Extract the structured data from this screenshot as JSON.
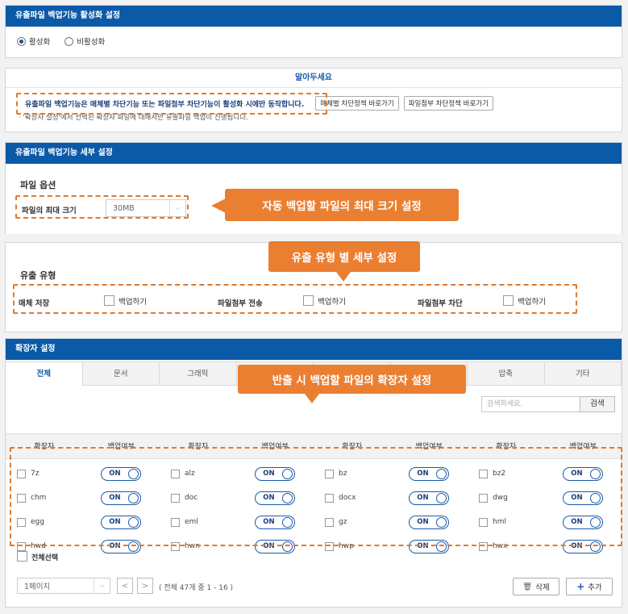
{
  "panel1": {
    "title": "유출파일 백업기능 활성화 설정",
    "radio_on": "활성화",
    "radio_off": "비활성화"
  },
  "notice": {
    "title": "알아두세요",
    "line1": "유출파일 백업기능은 매체별 차단기능 또는 파일첨부 차단기능이 활성화 시에만 동작합니다.",
    "btn_media": "매체별 차단정책 바로가기",
    "btn_attach": "파일첨부 차단정책 바로가기",
    "footnote": "· '확장자 설정'에서 선택된 확장자 파일에 대해서만 유출파일 백업이 진행됩니다."
  },
  "detail": {
    "title": "유출파일 백업기능 세부 설정",
    "file_option": "파일 옵션",
    "max_size_label": "파일의 최대 크기",
    "max_size_value": "30MB",
    "leak_type": "유출 유형",
    "types": [
      {
        "label": "매체 저장",
        "check": "백업하기"
      },
      {
        "label": "파일첨부 전송",
        "check": "백업하기"
      },
      {
        "label": "파일첨부 차단",
        "check": "백업하기"
      }
    ]
  },
  "callouts": {
    "max_size": "자동 백업할 파일의 최대 크기 설정",
    "leak_type": "유출 유형 별 세부 설정",
    "ext": "반출 시 백업할 파일의 확장자 설정"
  },
  "ext": {
    "title": "확장자 설정",
    "tabs": [
      "전체",
      "문서",
      "그래픽",
      "",
      "",
      "",
      "압축",
      "기타"
    ],
    "search_placeholder": "검색하세요.",
    "search_button": "검색",
    "col_ext": "확장자",
    "col_backup": "백업여부",
    "toggle_on": "ON",
    "rows": [
      [
        "7z",
        "alz",
        "bz",
        "bz2"
      ],
      [
        "chm",
        "doc",
        "docx",
        "dwg"
      ],
      [
        "egg",
        "eml",
        "gz",
        "hml"
      ],
      [
        "hwd",
        "hwn",
        "hwp",
        "hwx"
      ]
    ],
    "select_all": "전체선택",
    "page_select": "1페이지",
    "page_info": "( 전체 47개 중 1 - 16 )",
    "delete_btn": "삭제",
    "add_btn": "추가"
  },
  "colors": {
    "header_blue": "#0b5aa8",
    "callout_orange": "#ea7f32",
    "dash_orange": "#e07a2c"
  }
}
